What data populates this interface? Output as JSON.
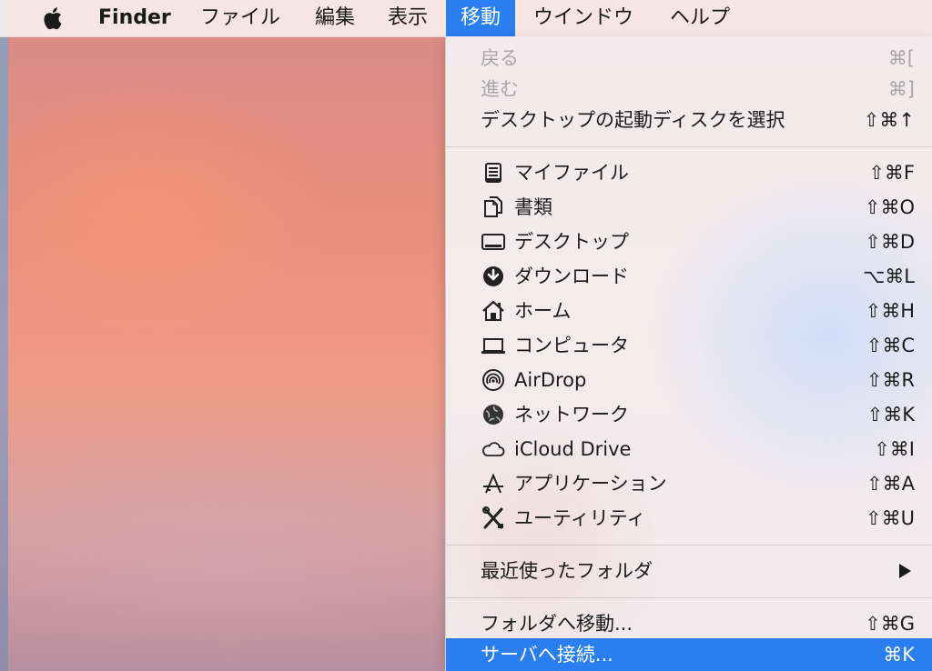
{
  "menubar": {
    "app_name": "Finder",
    "menus": [
      "ファイル",
      "編集",
      "表示",
      "移動",
      "ウインドウ",
      "ヘルプ"
    ],
    "active_menu": "移動"
  },
  "dropdown": {
    "top_items": [
      {
        "label": "戻る",
        "shortcut": "⌘[",
        "enabled": false
      },
      {
        "label": "進む",
        "shortcut": "⌘]",
        "enabled": false
      },
      {
        "label": "デスクトップの起動ディスクを選択",
        "shortcut": "⇧⌘↑",
        "enabled": true
      }
    ],
    "places": [
      {
        "label": "マイファイル",
        "shortcut": "⇧⌘F",
        "icon": "all-files-icon"
      },
      {
        "label": "書類",
        "shortcut": "⇧⌘O",
        "icon": "documents-icon"
      },
      {
        "label": "デスクトップ",
        "shortcut": "⇧⌘D",
        "icon": "desktop-icon"
      },
      {
        "label": "ダウンロード",
        "shortcut": "⌥⌘L",
        "icon": "download-icon"
      },
      {
        "label": "ホーム",
        "shortcut": "⇧⌘H",
        "icon": "home-icon"
      },
      {
        "label": "コンピュータ",
        "shortcut": "⇧⌘C",
        "icon": "computer-icon"
      },
      {
        "label": "AirDrop",
        "shortcut": "⇧⌘R",
        "icon": "airdrop-icon"
      },
      {
        "label": "ネットワーク",
        "shortcut": "⇧⌘K",
        "icon": "network-icon"
      },
      {
        "label": "iCloud Drive",
        "shortcut": "⇧⌘I",
        "icon": "icloud-icon"
      },
      {
        "label": "アプリケーション",
        "shortcut": "⇧⌘A",
        "icon": "applications-icon"
      },
      {
        "label": "ユーティリティ",
        "shortcut": "⇧⌘U",
        "icon": "utilities-icon"
      }
    ],
    "recent": {
      "label": "最近使ったフォルダ",
      "icon": "submenu-arrow-icon"
    },
    "goto": {
      "label": "フォルダへ移動...",
      "shortcut": "⇧⌘G"
    },
    "connect": {
      "label": "サーバへ接続...",
      "shortcut": "⌘K",
      "highlighted": true
    }
  },
  "colors": {
    "highlight": "#2a7ff0",
    "disabled_text": "#a9a6a8",
    "text": "#1b1b1b"
  }
}
